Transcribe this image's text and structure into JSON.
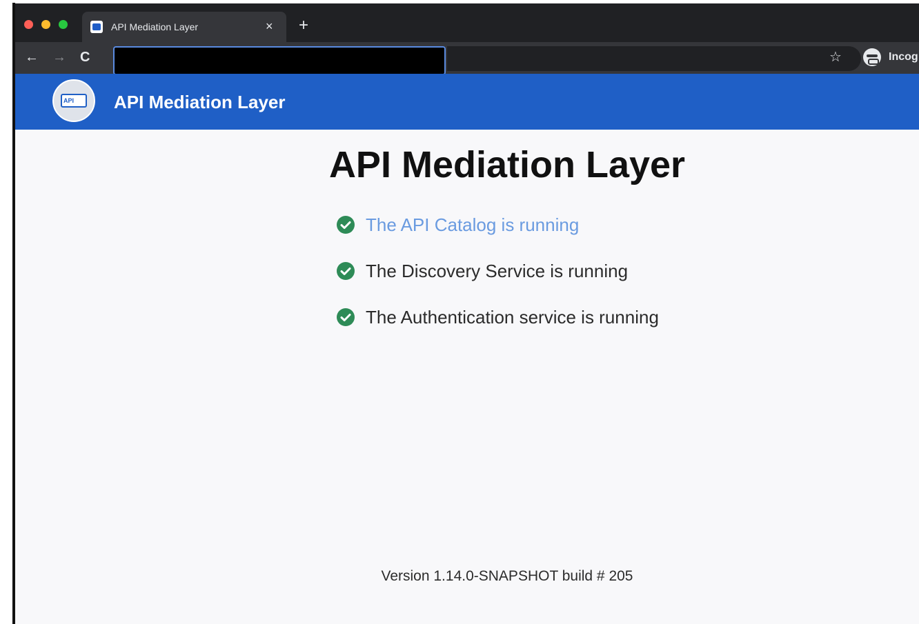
{
  "browser": {
    "tab": {
      "title": "API Mediation Layer",
      "close_label": "×"
    },
    "new_tab_label": "+",
    "toolbar": {
      "back_label": "←",
      "forward_label": "→",
      "reload_label": "C",
      "bookmark_label": "☆",
      "incognito_label": "Incog"
    }
  },
  "header": {
    "logo_text": "API",
    "title": "API Mediation Layer"
  },
  "main": {
    "title": "API Mediation Layer",
    "statuses": [
      {
        "label": "The API Catalog is running"
      },
      {
        "label": "The Discovery Service is running"
      },
      {
        "label": "The Authentication service is running"
      }
    ],
    "version": "Version 1.14.0-SNAPSHOT build # 205"
  },
  "colors": {
    "header_blue": "#1f5fc6",
    "check_green": "#2e8b57",
    "link_blue": "#6a9be0"
  }
}
